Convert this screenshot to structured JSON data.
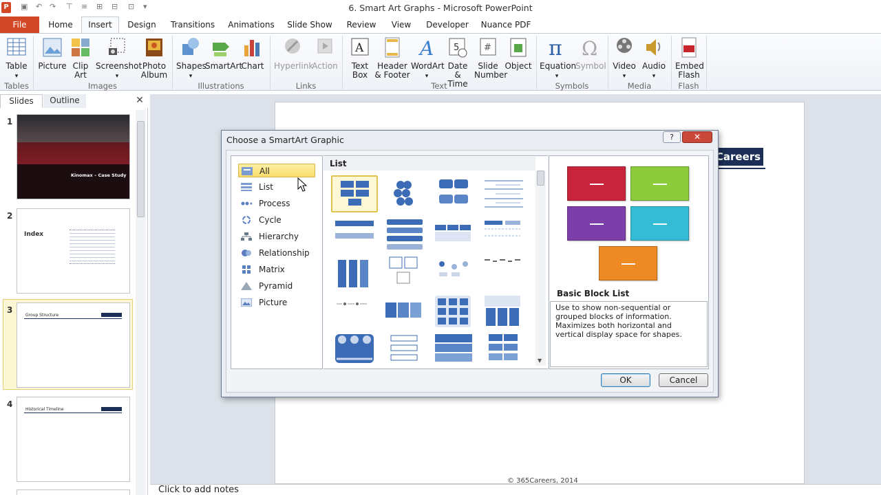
{
  "title_bar": {
    "title": "6. Smart Art Graphs - Microsoft PowerPoint"
  },
  "tabs": [
    "File",
    "Home",
    "Insert",
    "Design",
    "Transitions",
    "Animations",
    "Slide Show",
    "Review",
    "View",
    "Developer",
    "Nuance PDF"
  ],
  "ribbon": {
    "groups": [
      "Tables",
      "Images",
      "Illustrations",
      "Links",
      "Text",
      "Symbols",
      "Media",
      "Flash"
    ],
    "buttons": {
      "table": "Table",
      "picture": "Picture",
      "clip_art": "Clip Art",
      "screenshot": "Screenshot",
      "photo_album": "Photo Album",
      "shapes": "Shapes",
      "smartart": "SmartArt",
      "chart": "Chart",
      "hyperlink": "Hyperlink",
      "action": "Action",
      "text_box": "Text Box",
      "header_footer": "Header & Footer",
      "wordart": "WordArt",
      "date_time": "Date & Time",
      "slide_number": "Slide Number",
      "object": "Object",
      "equation": "Equation",
      "symbol": "Symbol",
      "video": "Video",
      "audio": "Audio",
      "embed_flash": "Embed Flash"
    }
  },
  "pane": {
    "slides_tab": "Slides",
    "outline_tab": "Outline"
  },
  "slides": [
    {
      "num": "1",
      "title": "Kinomax – Case Study"
    },
    {
      "num": "2",
      "title": "Index"
    },
    {
      "num": "3",
      "title": "Group Structure"
    },
    {
      "num": "4",
      "title": "Historical Timeline"
    }
  ],
  "slide_canvas": {
    "badge": "Careers",
    "copyright": "© 365Careers, 2014"
  },
  "notes": "Click to add notes",
  "dialog": {
    "title": "Choose a SmartArt Graphic",
    "categories": [
      "All",
      "List",
      "Process",
      "Cycle",
      "Hierarchy",
      "Relationship",
      "Matrix",
      "Pyramid",
      "Picture"
    ],
    "selected_category": "All",
    "layout_header": "List",
    "preview_name": "Basic Block List",
    "preview_description": "Use to show non-sequential or grouped blocks of information. Maximizes both horizontal and vertical display space for shapes.",
    "preview_colors": [
      "#c8243b",
      "#8ccc3c",
      "#7c3ea8",
      "#34bcd4",
      "#ee8a24"
    ],
    "ok": "OK",
    "cancel": "Cancel"
  }
}
